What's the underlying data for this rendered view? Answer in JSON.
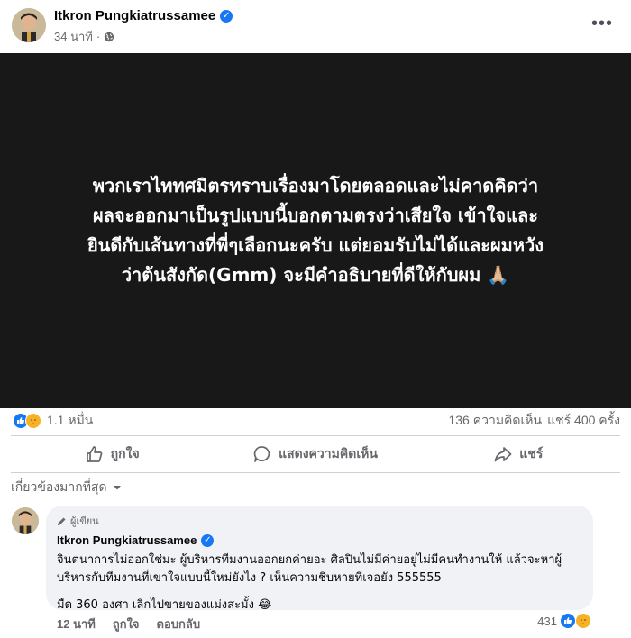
{
  "post": {
    "author": "Itkron Pungkiatrussamee",
    "time": "34 นาที",
    "menu_icon": "more-horizontal-icon",
    "image_text": "พวกเราไททศมิตรทราบเรื่องมาโดยตลอดและไม่คาดคิดว่า\nผลจะออกมาเป็นรูปแบบนี้บอกตามตรงว่าเสียใจ เข้าใจและ\nยินดีกับเส้นทางที่พี่ๆเลือกนะครับ แต่ยอมรับไม่ได้และผมหวัง\nว่าต้นสังกัด(Gmm) จะมีคำอธิบายที่ดีให้กับผม 🙏🏼"
  },
  "stats": {
    "reactions_count": "1.1 หมื่น",
    "comments": "136 ความคิดเห็น",
    "shares": "แชร์ 400 ครั้ง"
  },
  "actions": {
    "like": "ถูกใจ",
    "comment": "แสดงความคิดเห็น",
    "share": "แชร์"
  },
  "comments_sort": "เกี่ยวข้องมากที่สุด",
  "comment": {
    "badge": "ผู้เขียน",
    "author": "Itkron Pungkiatrussamee",
    "text_1": "จินตนาการไม่ออกใช่มะ ผู้บริหารทีมงานออกยกค่ายอะ ศิลปินไม่มีค่ายอยู่ไม่มีคนทำงานให้ แล้วจะหาผู้บริหารกับทีมงานที่เขาใจแบบนี้ใหม่ยังไง ? เห็นความชิบหายที่เจอยัง 555555",
    "text_2": "มืด 360 องศา เลิกไปขายของแม่งสะมั้ง 😂",
    "time": "12 นาที",
    "like": "ถูกใจ",
    "reply": "ตอบกลับ",
    "reactions_count": "431"
  },
  "colors": {
    "brand_blue": "#1877f2",
    "secondary_text": "#65676b",
    "image_bg": "#181818"
  }
}
